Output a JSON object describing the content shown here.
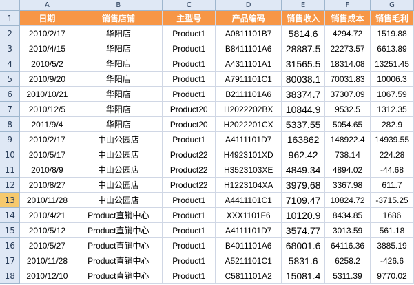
{
  "columns": [
    "A",
    "B",
    "C",
    "D",
    "E",
    "F",
    "G"
  ],
  "headers": [
    "日期",
    "销售店铺",
    "主型号",
    "产品编码",
    "销售收入",
    "销售成本",
    "销售毛利"
  ],
  "active_row": 13,
  "rows": [
    {
      "n": "2",
      "a": "2010/2/17",
      "b": "华阳店",
      "c": "Product1",
      "d": "A0811101B7",
      "e": "5814.6",
      "f": "4294.72",
      "g": "1519.88"
    },
    {
      "n": "3",
      "a": "2010/4/15",
      "b": "华阳店",
      "c": "Product1",
      "d": "B8411101A6",
      "e": "28887.5",
      "f": "22273.57",
      "g": "6613.89"
    },
    {
      "n": "4",
      "a": "2010/5/2",
      "b": "华阳店",
      "c": "Product1",
      "d": "A4311101A1",
      "e": "31565.5",
      "f": "18314.08",
      "g": "13251.45"
    },
    {
      "n": "5",
      "a": "2010/9/20",
      "b": "华阳店",
      "c": "Product1",
      "d": "A7911101C1",
      "e": "80038.1",
      "f": "70031.83",
      "g": "10006.3"
    },
    {
      "n": "6",
      "a": "2010/10/21",
      "b": "华阳店",
      "c": "Product1",
      "d": "B2111101A6",
      "e": "38374.7",
      "f": "37307.09",
      "g": "1067.59"
    },
    {
      "n": "7",
      "a": "2010/12/5",
      "b": "华阳店",
      "c": "Product20",
      "d": "H2022202BX",
      "e": "10844.9",
      "f": "9532.5",
      "g": "1312.35"
    },
    {
      "n": "8",
      "a": "2011/9/4",
      "b": "华阳店",
      "c": "Product20",
      "d": "H2022201CX",
      "e": "5337.55",
      "f": "5054.65",
      "g": "282.9"
    },
    {
      "n": "9",
      "a": "2010/2/17",
      "b": "中山公园店",
      "c": "Product1",
      "d": "A4111101D7",
      "e": "163862",
      "f": "148922.4",
      "g": "14939.55"
    },
    {
      "n": "10",
      "a": "2010/5/17",
      "b": "中山公园店",
      "c": "Product22",
      "d": "H4923101XD",
      "e": "962.42",
      "f": "738.14",
      "g": "224.28"
    },
    {
      "n": "11",
      "a": "2010/8/9",
      "b": "中山公园店",
      "c": "Product22",
      "d": "H3523103XE",
      "e": "4849.34",
      "f": "4894.02",
      "g": "-44.68"
    },
    {
      "n": "12",
      "a": "2010/8/27",
      "b": "中山公园店",
      "c": "Product22",
      "d": "H1223104XA",
      "e": "3979.68",
      "f": "3367.98",
      "g": "611.7"
    },
    {
      "n": "13",
      "a": "2010/11/28",
      "b": "中山公园店",
      "c": "Product1",
      "d": "A4411101C1",
      "e": "7109.47",
      "f": "10824.72",
      "g": "-3715.25"
    },
    {
      "n": "14",
      "a": "2010/4/21",
      "b": "Product直销中心",
      "c": "Product1",
      "d": "XXX1101F6",
      "e": "10120.9",
      "f": "8434.85",
      "g": "1686"
    },
    {
      "n": "15",
      "a": "2010/5/12",
      "b": "Product直销中心",
      "c": "Product1",
      "d": "A4111101D7",
      "e": "3574.77",
      "f": "3013.59",
      "g": "561.18"
    },
    {
      "n": "16",
      "a": "2010/5/27",
      "b": "Product直销中心",
      "c": "Product1",
      "d": "B4011101A6",
      "e": "68001.6",
      "f": "64116.36",
      "g": "3885.19"
    },
    {
      "n": "17",
      "a": "2010/11/28",
      "b": "Product直销中心",
      "c": "Product1",
      "d": "A5211101C1",
      "e": "5831.6",
      "f": "6258.2",
      "g": "-426.6"
    },
    {
      "n": "18",
      "a": "2010/12/10",
      "b": "Product直销中心",
      "c": "Product1",
      "d": "C5811101A2",
      "e": "15081.4",
      "f": "5311.39",
      "g": "9770.02"
    }
  ]
}
